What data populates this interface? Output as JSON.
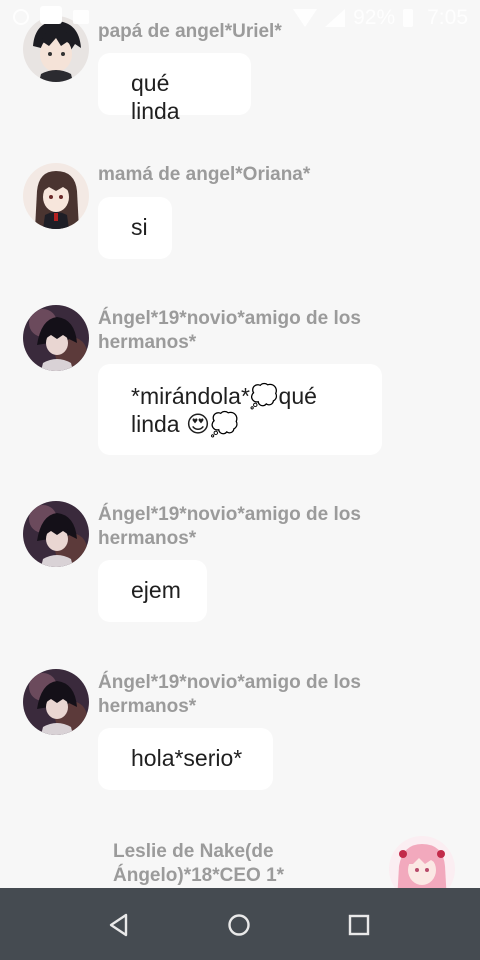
{
  "status_bar": {
    "battery": "92%",
    "time": "7:05",
    "icons": [
      "notification-icon",
      "square-icon",
      "image-icon",
      "wifi-icon",
      "signal-icon",
      "battery-icon"
    ]
  },
  "messages": [
    {
      "author": "papá de angel*Uriel*",
      "text": "qué linda",
      "side": "left",
      "avatar": "boy-avatar"
    },
    {
      "author": "mamá de angel*Oriana*",
      "text": "si",
      "side": "left",
      "avatar": "girl-avatar"
    },
    {
      "author": "Ángel*19*novio*amigo de los hermanos*",
      "text": "*mirándola*💭qué linda 😍💭",
      "side": "left",
      "avatar": "angel-avatar"
    },
    {
      "author": "Ángel*19*novio*amigo de los hermanos*",
      "text": "ejem",
      "side": "left",
      "avatar": "angel-avatar"
    },
    {
      "author": "Ángel*19*novio*amigo de los hermanos*",
      "text": "hola*serio*",
      "side": "left",
      "avatar": "angel-avatar"
    },
    {
      "author": "Leslie de Nake(de Ángelo)*18*CEO 1*",
      "text": "",
      "side": "right",
      "avatar": "pink-hair-avatar"
    }
  ],
  "nav": {
    "icons": [
      "back-icon",
      "home-icon",
      "recents-icon"
    ]
  },
  "colors": {
    "background": "#f7f7f7",
    "bubble": "#ffffff",
    "author": "#9b9b9b",
    "nav": "#454b51"
  }
}
